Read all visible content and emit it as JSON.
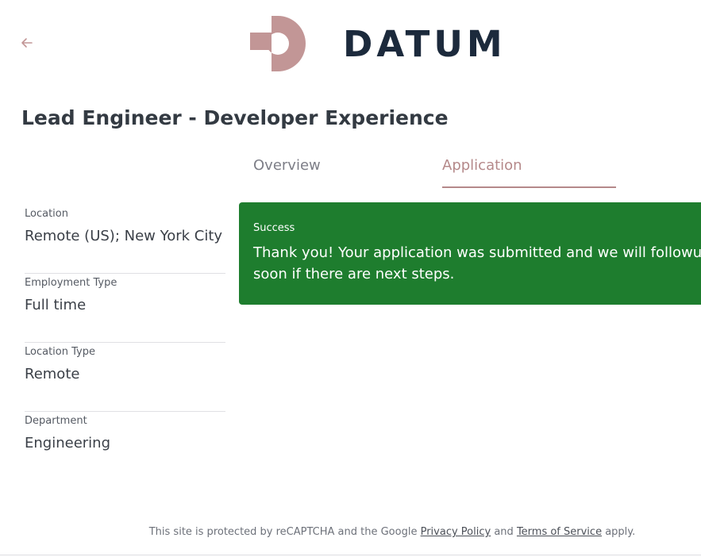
{
  "header": {
    "back_icon": "arrow-left-icon",
    "brand_name": "DATUM",
    "logo_color": "#c29696",
    "wordmark_color": "#1c2a3c"
  },
  "job": {
    "title": "Lead Engineer - Developer Experience"
  },
  "tabs": [
    {
      "label": "Overview",
      "active": false
    },
    {
      "label": "Application",
      "active": true
    }
  ],
  "sidebar": {
    "items": [
      {
        "label": "Location",
        "value": "Remote (US); New York City"
      },
      {
        "label": "Employment Type",
        "value": "Full time"
      },
      {
        "label": "Location Type",
        "value": "Remote"
      },
      {
        "label": "Department",
        "value": "Engineering"
      }
    ]
  },
  "alert": {
    "title": "Success",
    "message": "Thank you! Your application was submitted and we will followup soon if there are next steps.",
    "color": "#1e7d2e"
  },
  "footer": {
    "text_before": "This site is protected by reCAPTCHA and the Google ",
    "privacy_link": "Privacy Policy",
    "text_middle": " and ",
    "terms_link": "Terms of Service",
    "text_after": " apply."
  },
  "colors": {
    "accent": "#b5898a",
    "title_text": "#333a42"
  }
}
